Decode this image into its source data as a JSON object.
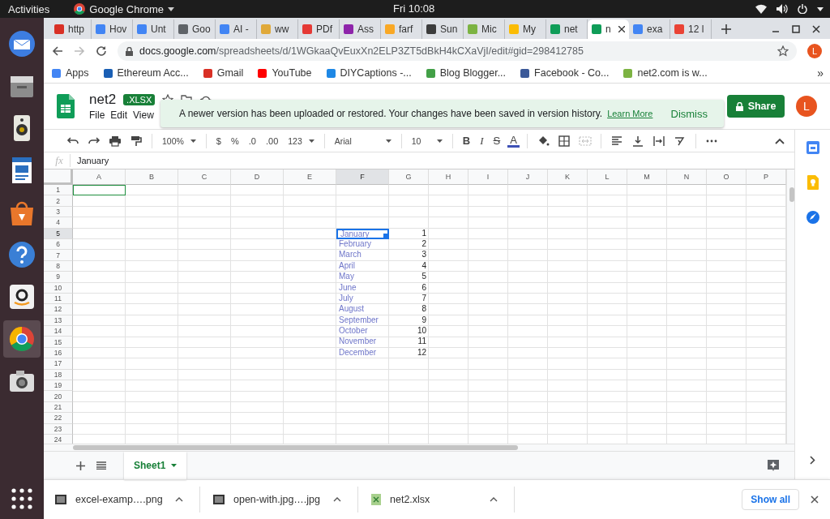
{
  "top_bar": {
    "activities": "Activities",
    "app_name": "Google Chrome",
    "clock": "Fri 10:08"
  },
  "dock": [
    {
      "kind": "mail",
      "selected": false
    },
    {
      "kind": "files",
      "selected": false
    },
    {
      "kind": "speaker",
      "selected": false
    },
    {
      "kind": "writer",
      "selected": false
    },
    {
      "kind": "store",
      "selected": false
    },
    {
      "kind": "help",
      "selected": false
    },
    {
      "kind": "amazon",
      "selected": false
    },
    {
      "kind": "chrome",
      "selected": true
    },
    {
      "kind": "camera",
      "selected": false
    }
  ],
  "tabs": [
    {
      "title": "http",
      "color": "#d93025",
      "selected": false
    },
    {
      "title": "Hov",
      "color": "#4285f4",
      "selected": false
    },
    {
      "title": "Unt",
      "color": "#4285f4",
      "selected": false
    },
    {
      "title": "Goo",
      "color": "#5f6368",
      "selected": false
    },
    {
      "title": "AI -",
      "color": "#4285f4",
      "selected": false
    },
    {
      "title": "ww",
      "color": "#e0a93a",
      "selected": false
    },
    {
      "title": "PDf",
      "color": "#e53935",
      "selected": false
    },
    {
      "title": "Ass",
      "color": "#8e24aa",
      "selected": false
    },
    {
      "title": "farf",
      "color": "#f9a825",
      "selected": false
    },
    {
      "title": "Sun",
      "color": "#3c3c3c",
      "selected": false
    },
    {
      "title": "Mic",
      "color": "#7cb342",
      "selected": false
    },
    {
      "title": "My",
      "color": "#fbbc04",
      "selected": false
    },
    {
      "title": "net",
      "color": "#0f9d58",
      "selected": false
    },
    {
      "title": "n",
      "color": "#0f9d58",
      "selected": true
    },
    {
      "title": "exa",
      "color": "#4285f4",
      "selected": false
    },
    {
      "title": "12 l",
      "color": "#ea4335",
      "selected": false
    }
  ],
  "address": {
    "host": "docs.google.com",
    "path": "/spreadsheets/d/1WGkaaQvEuxXn2ELP3ZT5dBkH4kCXaVjI/edit#gid=298412785",
    "avatar": "L"
  },
  "bookmarks": [
    {
      "label": "Apps",
      "color": "#4285f4"
    },
    {
      "label": "Ethereum Acc...",
      "color": "#1a5fb4"
    },
    {
      "label": "Gmail",
      "color": "#d93025"
    },
    {
      "label": "YouTube",
      "color": "#ff0000"
    },
    {
      "label": "DIYCaptions -...",
      "color": "#1e88e5"
    },
    {
      "label": "Blog Blogger...",
      "color": "#43a047"
    },
    {
      "label": "Facebook - Co...",
      "color": "#3b5998"
    },
    {
      "label": "net2.com is w...",
      "color": "#7cb342"
    }
  ],
  "bookmarks_more": "»",
  "document": {
    "title": "net2",
    "badge": ".XLSX",
    "menu": [
      "File",
      "Edit",
      "View"
    ],
    "share": "Share",
    "avatar": "L"
  },
  "notice": {
    "text": "A newer version has been uploaded or restored. Your changes have been saved in version history.",
    "link": "Learn More",
    "dismiss": "Dismiss"
  },
  "toolbar": [
    {
      "kind": "undo"
    },
    {
      "kind": "redo"
    },
    {
      "kind": "print"
    },
    {
      "kind": "paint"
    },
    {
      "kind": "sep"
    },
    {
      "kind": "select",
      "label": "100%"
    },
    {
      "kind": "sep"
    },
    {
      "kind": "text",
      "label": "$"
    },
    {
      "kind": "text",
      "label": "%"
    },
    {
      "kind": "text",
      "label": ".0"
    },
    {
      "kind": "text",
      "label": ".00"
    },
    {
      "kind": "select",
      "label": "123"
    },
    {
      "kind": "sep"
    },
    {
      "kind": "font",
      "label": "Arial"
    },
    {
      "kind": "sep"
    },
    {
      "kind": "size",
      "label": "10"
    },
    {
      "kind": "sep"
    },
    {
      "kind": "bold",
      "label": "B"
    },
    {
      "kind": "italic",
      "label": "I"
    },
    {
      "kind": "strike",
      "label": "S"
    },
    {
      "kind": "color",
      "label": "A"
    },
    {
      "kind": "sep"
    },
    {
      "kind": "fill"
    },
    {
      "kind": "borders"
    },
    {
      "kind": "merge"
    },
    {
      "kind": "sep"
    },
    {
      "kind": "align"
    },
    {
      "kind": "valign"
    },
    {
      "kind": "wrap"
    },
    {
      "kind": "rotate"
    },
    {
      "kind": "sep"
    },
    {
      "kind": "more"
    }
  ],
  "formula": {
    "fx": "fx",
    "value": "January"
  },
  "grid": {
    "columns": [
      {
        "label": "A",
        "selected": false,
        "collaborator": true
      },
      {
        "label": "B",
        "selected": false
      },
      {
        "label": "C",
        "selected": false
      },
      {
        "label": "D",
        "selected": false
      },
      {
        "label": "E",
        "selected": false
      },
      {
        "label": "F",
        "selected": true
      },
      {
        "label": "G",
        "selected": false
      },
      {
        "label": "H",
        "selected": false
      },
      {
        "label": "I",
        "selected": false
      },
      {
        "label": "J",
        "selected": false
      },
      {
        "label": "K",
        "selected": false
      },
      {
        "label": "L",
        "selected": false
      },
      {
        "label": "M",
        "selected": false
      },
      {
        "label": "N",
        "selected": false
      },
      {
        "label": "O",
        "selected": false
      },
      {
        "label": "P",
        "selected": false
      }
    ],
    "rows": [
      {
        "label": "1",
        "selected": false,
        "collaborator": true
      },
      {
        "label": "2",
        "selected": false
      },
      {
        "label": "3",
        "selected": false
      },
      {
        "label": "4",
        "selected": false
      },
      {
        "label": "5",
        "selected": true,
        "F": "January",
        "G": "1"
      },
      {
        "label": "6",
        "selected": false,
        "F": "February",
        "G": "2"
      },
      {
        "label": "7",
        "selected": false,
        "F": "March",
        "G": "3"
      },
      {
        "label": "8",
        "selected": false,
        "F": "April",
        "G": "4"
      },
      {
        "label": "9",
        "selected": false,
        "F": "May",
        "G": "5"
      },
      {
        "label": "10",
        "selected": false,
        "F": "June",
        "G": "6"
      },
      {
        "label": "11",
        "selected": false,
        "F": "July",
        "G": "7"
      },
      {
        "label": "12",
        "selected": false,
        "F": "August",
        "G": "8"
      },
      {
        "label": "13",
        "selected": false,
        "F": "September",
        "G": "9"
      },
      {
        "label": "14",
        "selected": false,
        "F": "October",
        "G": "10"
      },
      {
        "label": "15",
        "selected": false,
        "F": "November",
        "G": "11"
      },
      {
        "label": "16",
        "selected": false,
        "F": "December",
        "G": "12"
      },
      {
        "label": "17",
        "selected": false
      },
      {
        "label": "18",
        "selected": false
      },
      {
        "label": "19",
        "selected": false
      },
      {
        "label": "20",
        "selected": false
      },
      {
        "label": "21",
        "selected": false
      },
      {
        "label": "22",
        "selected": false
      },
      {
        "label": "23",
        "selected": false
      },
      {
        "label": "24",
        "selected": false
      }
    ]
  },
  "sheets": [
    {
      "name": "Sheet1",
      "selected": true
    }
  ],
  "downloads": {
    "items": [
      {
        "name": "excel-examp….png",
        "kind": "image"
      },
      {
        "name": "open-with.jpg….jpg",
        "kind": "image"
      },
      {
        "name": "net2.xlsx",
        "kind": "sheet"
      }
    ],
    "show_all": "Show all"
  }
}
